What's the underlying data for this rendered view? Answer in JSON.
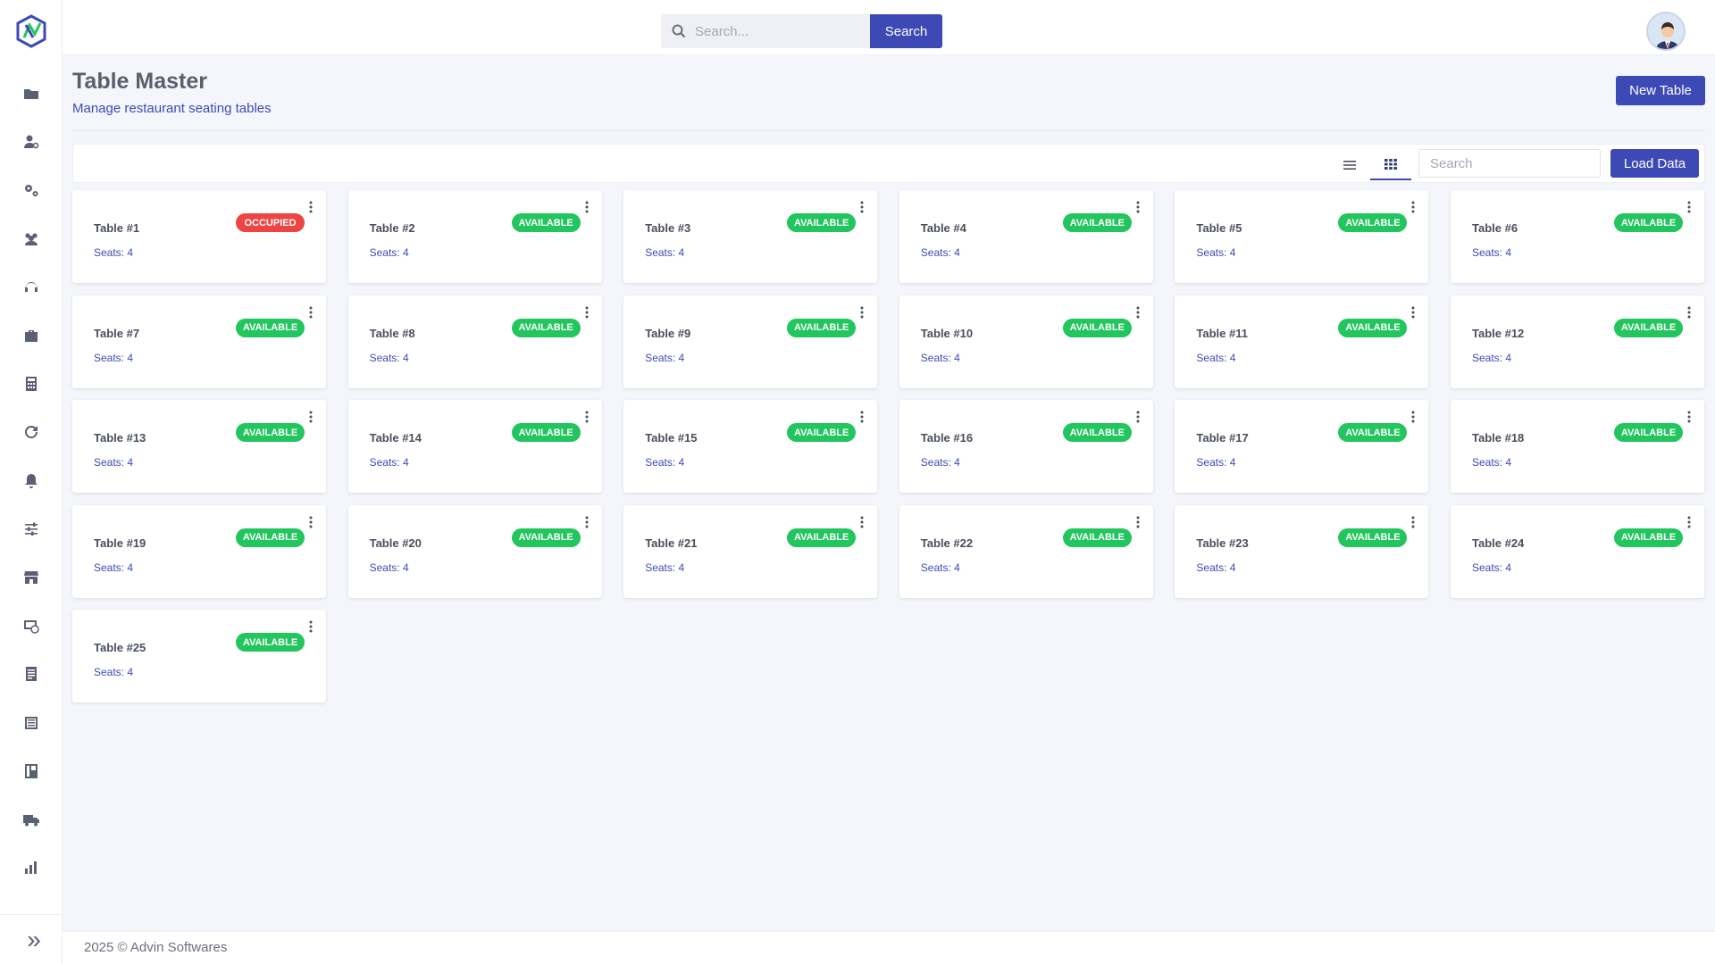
{
  "topbar": {
    "search_placeholder": "Search...",
    "search_button": "Search"
  },
  "header": {
    "title": "Table Master",
    "subtitle": "Manage restaurant seating tables",
    "new_button": "New Table"
  },
  "toolbar": {
    "search_placeholder": "Search",
    "load_button": "Load Data",
    "active_view": "grid"
  },
  "status_colors": {
    "AVAILABLE": "#22c55e",
    "OCCUPIED": "#ef4444"
  },
  "sidebar": {
    "icons": [
      "folder-icon",
      "user-settings-icon",
      "gears-icon",
      "users-icon",
      "headset-icon",
      "briefcase-icon",
      "calculator-icon",
      "refresh-icon",
      "bell-icon",
      "sliders-icon",
      "store-icon",
      "money-icon",
      "report-icon",
      "list-icon",
      "menu-board-icon",
      "truck-icon",
      "bar-chart-icon"
    ]
  },
  "tables": [
    {
      "name": "Table #1",
      "seats": "Seats: 4",
      "status": "OCCUPIED"
    },
    {
      "name": "Table #2",
      "seats": "Seats: 4",
      "status": "AVAILABLE"
    },
    {
      "name": "Table #3",
      "seats": "Seats: 4",
      "status": "AVAILABLE"
    },
    {
      "name": "Table #4",
      "seats": "Seats: 4",
      "status": "AVAILABLE"
    },
    {
      "name": "Table #5",
      "seats": "Seats: 4",
      "status": "AVAILABLE"
    },
    {
      "name": "Table #6",
      "seats": "Seats: 4",
      "status": "AVAILABLE"
    },
    {
      "name": "Table #7",
      "seats": "Seats: 4",
      "status": "AVAILABLE"
    },
    {
      "name": "Table #8",
      "seats": "Seats: 4",
      "status": "AVAILABLE"
    },
    {
      "name": "Table #9",
      "seats": "Seats: 4",
      "status": "AVAILABLE"
    },
    {
      "name": "Table #10",
      "seats": "Seats: 4",
      "status": "AVAILABLE"
    },
    {
      "name": "Table #11",
      "seats": "Seats: 4",
      "status": "AVAILABLE"
    },
    {
      "name": "Table #12",
      "seats": "Seats: 4",
      "status": "AVAILABLE"
    },
    {
      "name": "Table #13",
      "seats": "Seats: 4",
      "status": "AVAILABLE"
    },
    {
      "name": "Table #14",
      "seats": "Seats: 4",
      "status": "AVAILABLE"
    },
    {
      "name": "Table #15",
      "seats": "Seats: 4",
      "status": "AVAILABLE"
    },
    {
      "name": "Table #16",
      "seats": "Seats: 4",
      "status": "AVAILABLE"
    },
    {
      "name": "Table #17",
      "seats": "Seats: 4",
      "status": "AVAILABLE"
    },
    {
      "name": "Table #18",
      "seats": "Seats: 4",
      "status": "AVAILABLE"
    },
    {
      "name": "Table #19",
      "seats": "Seats: 4",
      "status": "AVAILABLE"
    },
    {
      "name": "Table #20",
      "seats": "Seats: 4",
      "status": "AVAILABLE"
    },
    {
      "name": "Table #21",
      "seats": "Seats: 4",
      "status": "AVAILABLE"
    },
    {
      "name": "Table #22",
      "seats": "Seats: 4",
      "status": "AVAILABLE"
    },
    {
      "name": "Table #23",
      "seats": "Seats: 4",
      "status": "AVAILABLE"
    },
    {
      "name": "Table #24",
      "seats": "Seats: 4",
      "status": "AVAILABLE"
    },
    {
      "name": "Table #25",
      "seats": "Seats: 4",
      "status": "AVAILABLE"
    }
  ],
  "footer": {
    "text": "2025 © Advin Softwares"
  }
}
